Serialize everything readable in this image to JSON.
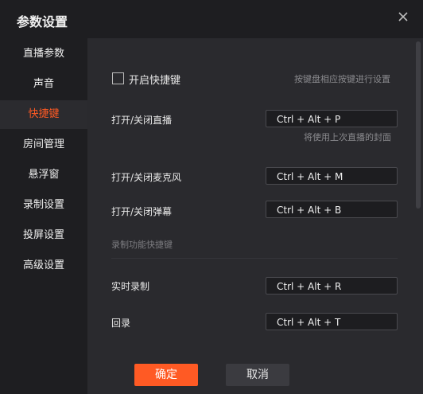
{
  "window": {
    "title": "参数设置",
    "close_icon": "close-icon"
  },
  "sidebar": {
    "items": [
      {
        "label": "直播参数"
      },
      {
        "label": "声音"
      },
      {
        "label": "快捷键"
      },
      {
        "label": "房间管理"
      },
      {
        "label": "悬浮窗"
      },
      {
        "label": "录制设置"
      },
      {
        "label": "投屏设置"
      },
      {
        "label": "高级设置"
      }
    ]
  },
  "content": {
    "enable_hotkeys": {
      "label": "开启快捷键",
      "checked": false
    },
    "enable_hint": "按键盘相应按键进行设置",
    "rows": [
      {
        "label": "打开/关闭直播",
        "value": "Ctrl + Alt + P",
        "hint": "将使用上次直播的封面"
      },
      {
        "label": "打开/关闭麦克风",
        "value": "Ctrl + Alt + M"
      },
      {
        "label": "打开/关闭弹幕",
        "value": "Ctrl + Alt + B"
      }
    ],
    "record_section": {
      "title": "录制功能快捷键"
    },
    "record_rows": [
      {
        "label": "实时录制",
        "value": "Ctrl + Alt + R"
      },
      {
        "label": "回录",
        "value": "Ctrl + Alt + T"
      }
    ]
  },
  "footer": {
    "ok": "确定",
    "cancel": "取消"
  },
  "colors": {
    "accent": "#ff5a24",
    "background": "#2a2a2e",
    "sidebar": "#1e1e21"
  }
}
